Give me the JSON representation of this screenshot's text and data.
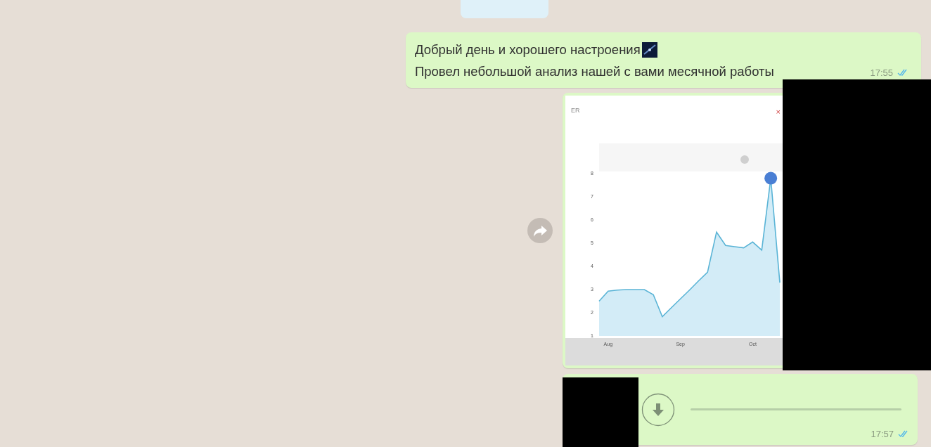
{
  "messages": [
    {
      "kind": "text",
      "lines": [
        "Добрый день и хорошего настроения",
        "Провел небольшой анализ нашей с вами месячной работы"
      ],
      "time": "17:55",
      "read": true
    },
    {
      "kind": "image",
      "image": {
        "title": "ER",
        "close_glyph": "×",
        "chart_data": {
          "type": "area",
          "categories": [
            null,
            "Aug",
            null,
            null,
            null,
            null,
            null,
            null,
            null,
            "Sep",
            null,
            null,
            null,
            null,
            null,
            null,
            null,
            "Oct",
            null,
            null,
            null
          ],
          "series": [
            {
              "color": "#5ab4d6",
              "values": [
                2.5,
                2.93,
                2.98,
                3.0,
                3.0,
                3.0,
                2.78,
                1.83,
                2.22,
                2.6,
                2.98,
                3.37,
                3.75,
                5.48,
                4.9,
                4.85,
                4.8,
                5.05,
                4.7,
                7.8,
                3.3
              ]
            }
          ],
          "yticks": [
            1,
            2,
            3,
            4,
            5,
            6,
            7,
            8
          ],
          "ylim": [
            1,
            8
          ]
        }
      }
    },
    {
      "kind": "audio",
      "time": "17:57",
      "read": true
    }
  ]
}
